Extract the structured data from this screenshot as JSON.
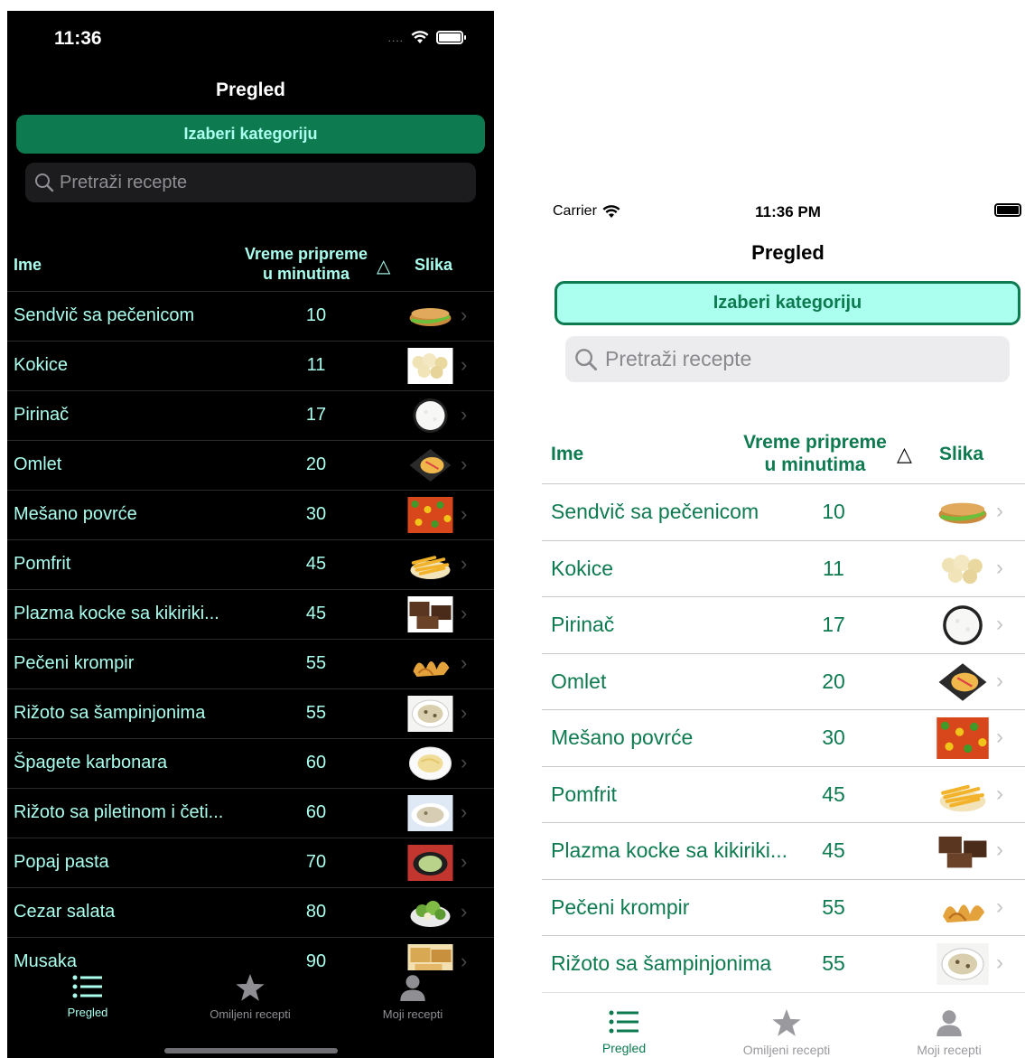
{
  "dark": {
    "status": {
      "time": "11:36",
      "dots": "...."
    },
    "nav_title": "Pregled",
    "category_button": "Izaberi kategoriju",
    "search_placeholder": "Pretraži recepte",
    "columns": {
      "name": "Ime",
      "time_line1": "Vreme pripreme",
      "time_line2": "u minutima",
      "sort": "△",
      "image": "Slika"
    },
    "rows": [
      {
        "name": "Sendvič sa pečenicom",
        "minutes": "10",
        "icon": "sandwich-thumb"
      },
      {
        "name": "Kokice",
        "minutes": "11",
        "icon": "popcorn-thumb"
      },
      {
        "name": "Pirinač",
        "minutes": "17",
        "icon": "rice-thumb"
      },
      {
        "name": "Omlet",
        "minutes": "20",
        "icon": "omelette-thumb"
      },
      {
        "name": "Mešano povrće",
        "minutes": "30",
        "icon": "vegetables-thumb"
      },
      {
        "name": "Pomfrit",
        "minutes": "45",
        "icon": "fries-thumb"
      },
      {
        "name": "Plazma kocke sa kikiriki...",
        "minutes": "45",
        "icon": "cake-thumb"
      },
      {
        "name": "Pečeni krompir",
        "minutes": "55",
        "icon": "potato-thumb"
      },
      {
        "name": "Rižoto sa šampinjonima",
        "minutes": "55",
        "icon": "risotto-thumb"
      },
      {
        "name": "Špagete karbonara",
        "minutes": "60",
        "icon": "pasta-thumb"
      },
      {
        "name": "Rižoto sa piletinom i četi...",
        "minutes": "60",
        "icon": "risotto-chicken-thumb"
      },
      {
        "name": "Popaj pasta",
        "minutes": "70",
        "icon": "spinach-pasta-thumb"
      },
      {
        "name": "Cezar salata",
        "minutes": "80",
        "icon": "salad-thumb"
      },
      {
        "name": "Musaka",
        "minutes": "90",
        "icon": "moussaka-thumb"
      }
    ],
    "tabs": [
      {
        "label": "Pregled",
        "icon": "list-icon",
        "active": true
      },
      {
        "label": "Omiljeni recepti",
        "icon": "star-icon",
        "active": false
      },
      {
        "label": "Moji recepti",
        "icon": "person-icon",
        "active": false
      }
    ]
  },
  "light": {
    "status": {
      "carrier": "Carrier",
      "time": "11:36 PM"
    },
    "nav_title": "Pregled",
    "category_button": "Izaberi kategoriju",
    "search_placeholder": "Pretraži recepte",
    "columns": {
      "name": "Ime",
      "time_line1": "Vreme pripreme",
      "time_line2": "u minutima",
      "sort": "△",
      "image": "Slika"
    },
    "rows": [
      {
        "name": "Sendvič sa pečenicom",
        "minutes": "10",
        "icon": "sandwich-thumb"
      },
      {
        "name": "Kokice",
        "minutes": "11",
        "icon": "popcorn-thumb"
      },
      {
        "name": "Pirinač",
        "minutes": "17",
        "icon": "rice-thumb"
      },
      {
        "name": "Omlet",
        "minutes": "20",
        "icon": "omelette-thumb"
      },
      {
        "name": "Mešano povrće",
        "minutes": "30",
        "icon": "vegetables-thumb"
      },
      {
        "name": "Pomfrit",
        "minutes": "45",
        "icon": "fries-thumb"
      },
      {
        "name": "Plazma kocke sa kikiriki...",
        "minutes": "45",
        "icon": "cake-thumb"
      },
      {
        "name": "Pečeni krompir",
        "minutes": "55",
        "icon": "potato-thumb"
      },
      {
        "name": "Rižoto sa šampinjonima",
        "minutes": "55",
        "icon": "risotto-thumb"
      }
    ],
    "tabs": [
      {
        "label": "Pregled",
        "icon": "list-icon",
        "active": true
      },
      {
        "label": "Omiljeni recepti",
        "icon": "star-icon",
        "active": false
      },
      {
        "label": "Moji recepti",
        "icon": "person-icon",
        "active": false
      }
    ]
  },
  "colors": {
    "accent": "#0e7a50",
    "mint": "#aaffee"
  }
}
